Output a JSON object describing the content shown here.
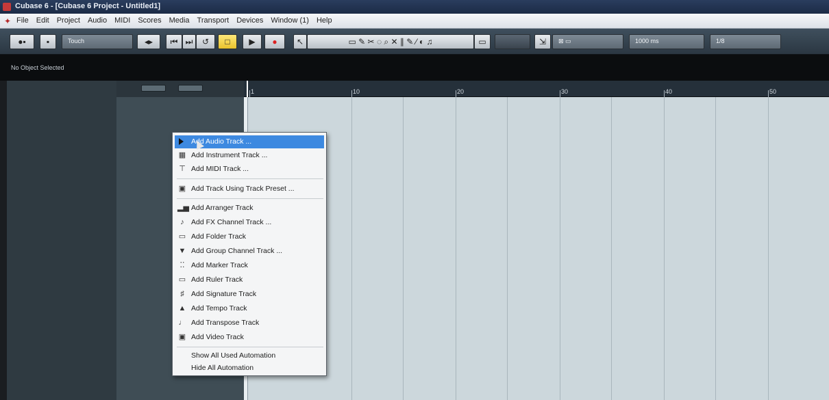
{
  "window": {
    "title": "Cubase 6 - [Cubase 6 Project - Untitled1]"
  },
  "menubar": {
    "items": [
      "File",
      "Edit",
      "Project",
      "Audio",
      "MIDI",
      "Scores",
      "Media",
      "Transport",
      "Devices",
      "Window (1)",
      "Help"
    ]
  },
  "toolbar": {
    "touch_mode": "Touch",
    "quantize_value": "1000 ms",
    "grid_value": "1/8"
  },
  "infoline": {
    "status": "No Object Selected"
  },
  "ruler": {
    "labels": [
      "1",
      "10",
      "20",
      "30",
      "40",
      "50"
    ]
  },
  "context_menu": {
    "items": [
      {
        "label": "Add Audio Track ...",
        "icon": "audio-track-icon",
        "selected": true
      },
      {
        "label": "Add Instrument Track ...",
        "icon": "instrument-track-icon"
      },
      {
        "label": "Add MIDI Track ...",
        "icon": "midi-track-icon"
      },
      {
        "label": "Add Track Using Track Preset ...",
        "icon": "track-preset-icon"
      },
      {
        "label": "Add Arranger Track",
        "icon": "arranger-track-icon"
      },
      {
        "label": "Add FX Channel Track ...",
        "icon": "fx-channel-icon"
      },
      {
        "label": "Add Folder Track",
        "icon": "folder-icon"
      },
      {
        "label": "Add Group Channel Track ...",
        "icon": "group-channel-icon"
      },
      {
        "label": "Add Marker Track",
        "icon": "marker-track-icon"
      },
      {
        "label": "Add Ruler Track",
        "icon": "ruler-track-icon"
      },
      {
        "label": "Add Signature Track",
        "icon": "signature-track-icon"
      },
      {
        "label": "Add Tempo Track",
        "icon": "tempo-track-icon"
      },
      {
        "label": "Add Transpose Track",
        "icon": "transpose-track-icon"
      },
      {
        "label": "Add Video Track",
        "icon": "video-track-icon"
      },
      {
        "label": "Show All Used Automation",
        "icon": ""
      },
      {
        "label": "Hide All Automation",
        "icon": ""
      }
    ]
  }
}
